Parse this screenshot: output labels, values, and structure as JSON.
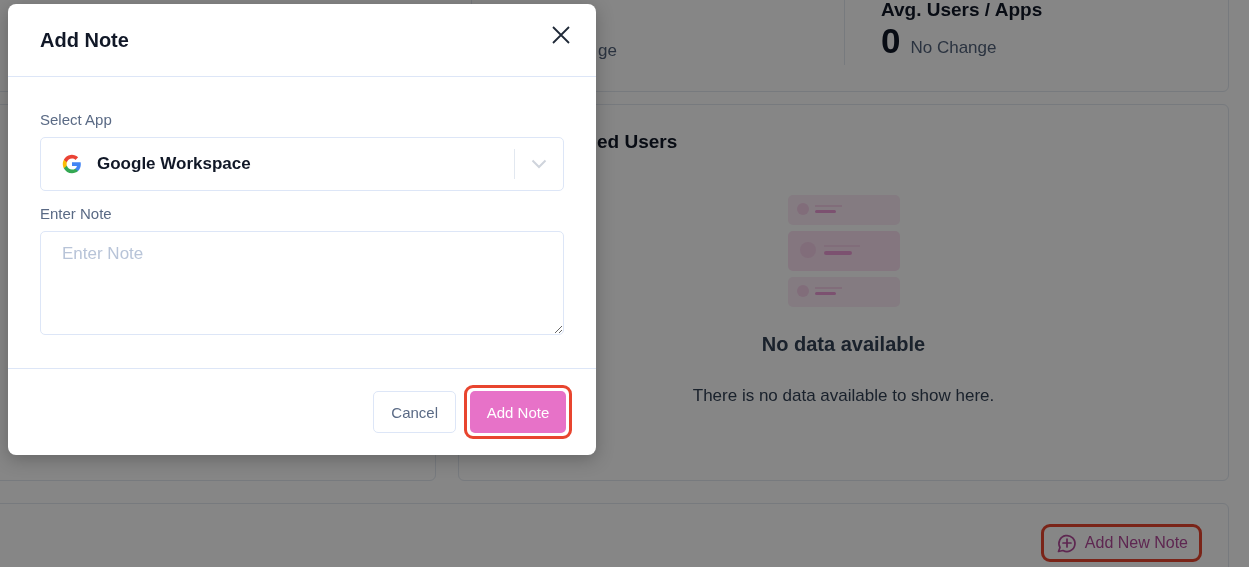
{
  "dashboard": {
    "stat_fragment": "ge",
    "stat": {
      "title": "Avg. Users / Apps",
      "value": "0",
      "change": "No Change"
    },
    "panel_title": "ed Users",
    "empty_state": {
      "title": "No data available",
      "message": "There is no data available to show here."
    },
    "add_note_link": {
      "label": "Add New Note",
      "highlighted": true
    }
  },
  "dialog": {
    "title": "Add Note",
    "fields": [
      {
        "kind": "select",
        "label": "Select App",
        "value": "Google Workspace"
      },
      {
        "kind": "textarea",
        "label": "Enter Note",
        "placeholder": "Enter Note"
      }
    ],
    "buttons": [
      {
        "label": "Cancel",
        "kind": "secondary",
        "highlighted": false
      },
      {
        "label": "Add Note",
        "kind": "primary",
        "highlighted": true
      }
    ]
  }
}
